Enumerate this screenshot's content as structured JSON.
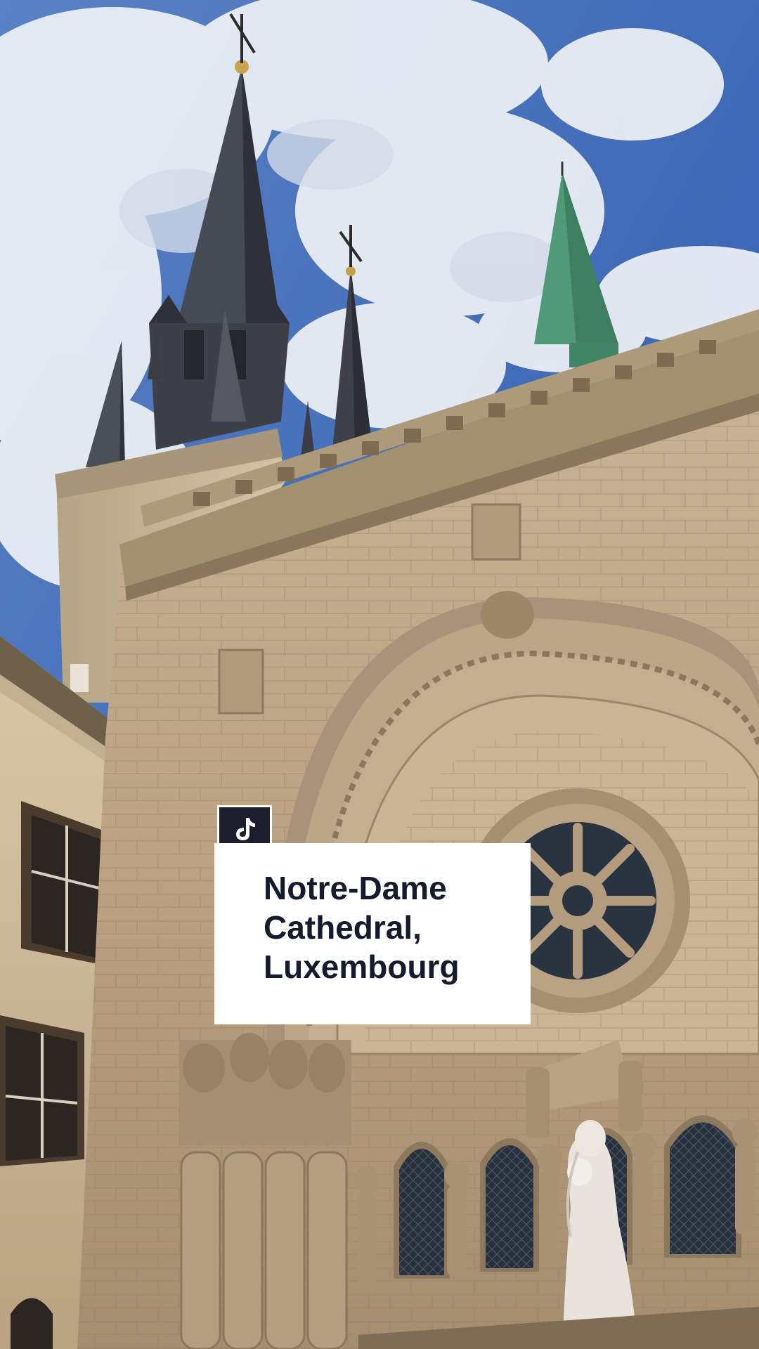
{
  "image": {
    "subject": "photo",
    "palette": {
      "sky": "#3f6cb8",
      "cloud": "#eef1f6",
      "stone": "#bda687",
      "stone_shadow": "#8e7a60",
      "slate_spire": "#3a3d44",
      "copper_spire": "#4f9a78",
      "window_glass": "#2a3340",
      "statue": "#e8e4dc"
    }
  },
  "overlay": {
    "badge_icon": "tiktok-logo-icon",
    "badge_color": "#1c1f2b",
    "caption_lines": [
      "Notre-Dame",
      "Cathedral,",
      "Luxembourg"
    ],
    "caption_text_color": "#161a2d",
    "caption_bg": "#ffffff"
  }
}
